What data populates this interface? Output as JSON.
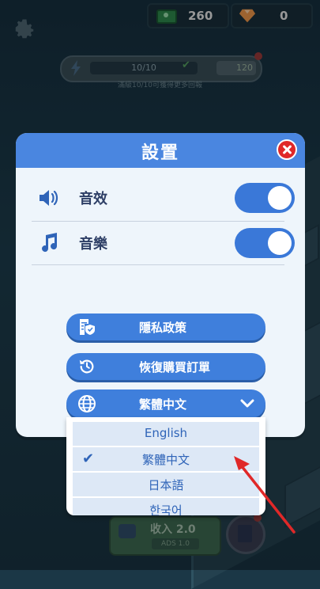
{
  "hud": {
    "cash_value": "260",
    "gems_value": "0"
  },
  "energy": {
    "progress": "10/10",
    "side_value": "120",
    "hint": "滿級10/10可獲得更多回報"
  },
  "bottom_bar": {
    "income_label": "收入 2.0",
    "income_sub": "ADS 1.0"
  },
  "settings": {
    "title": "設置",
    "sound_effects": {
      "label": "音效",
      "enabled": true
    },
    "music": {
      "label": "音樂",
      "enabled": true
    },
    "privacy_label": "隱私政策",
    "restore_label": "恢復購買訂單",
    "language": {
      "selected": "繁體中文",
      "options": [
        "English",
        "繁體中文",
        "日本語",
        "한국어"
      ]
    }
  },
  "colors": {
    "accent": "#3f7fdc",
    "header": "#4a86e0",
    "close": "#e02828",
    "annotation_arrow": "#e02828"
  }
}
